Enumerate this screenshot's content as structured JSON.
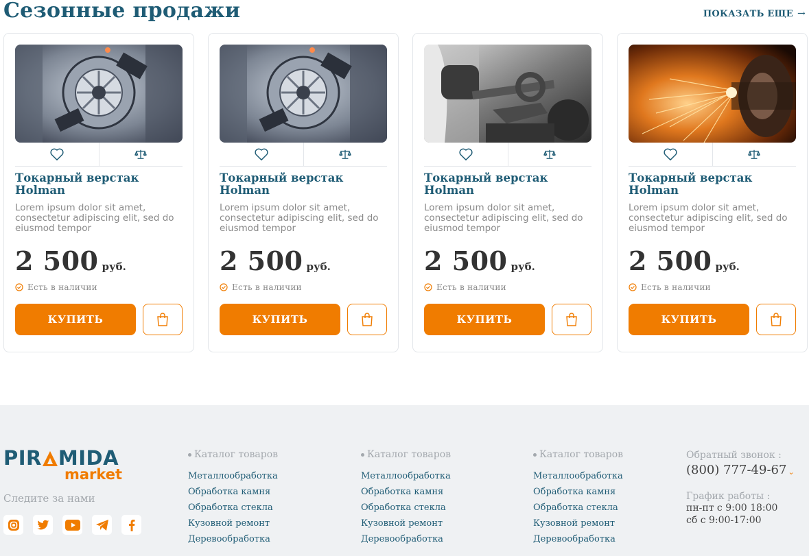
{
  "section": {
    "title": "Сезонные продажи",
    "show_more": "ПОКАЗАТЬ ЕЩЕ"
  },
  "products": [
    {
      "image": "lathe-machine-photo",
      "title": "Токарный верстак Holman",
      "description": "Lorem ipsum dolor sit amet, consectetur adipiscing elit, sed do eiusmod tempor",
      "price": "2 500",
      "currency": "руб.",
      "stock": "Есть в наличии",
      "buy_label": "КУПИТЬ"
    },
    {
      "image": "lathe-machine-photo",
      "title": "Токарный верстак Holman",
      "description": "Lorem ipsum dolor sit amet, consectetur adipiscing elit, sed do eiusmod tempor",
      "price": "2 500",
      "currency": "руб.",
      "stock": "Есть в наличии",
      "buy_label": "КУПИТЬ"
    },
    {
      "image": "wrench-worker-photo",
      "title": "Токарный верстак Holman",
      "description": "Lorem ipsum dolor sit amet, consectetur adipiscing elit, sed do eiusmod tempor",
      "price": "2 500",
      "currency": "руб.",
      "stock": "Есть в наличии",
      "buy_label": "КУПИТЬ"
    },
    {
      "image": "grinding-sparks-photo",
      "title": "Токарный верстак Holman",
      "description": "Lorem ipsum dolor sit amet, consectetur adipiscing elit, sed do eiusmod tempor",
      "price": "2 500",
      "currency": "руб.",
      "stock": "Есть в наличии",
      "buy_label": "КУПИТЬ"
    }
  ],
  "footer": {
    "logo": {
      "top_pre": "PIR",
      "top_post": "MIDA",
      "bottom": "market"
    },
    "follow": "Следите за нами",
    "socials": [
      "instagram-icon",
      "twitter-icon",
      "youtube-icon",
      "telegram-icon",
      "facebook-icon"
    ],
    "columns": [
      {
        "heading": "Каталог товаров",
        "links": [
          "Металлообработка",
          "Обработка камня",
          "Обработка стекла",
          "Кузовной ремонт",
          "Деревообработка"
        ]
      },
      {
        "heading": "Каталог товаров",
        "links": [
          "Металлообработка",
          "Обработка камня",
          "Обработка стекла",
          "Кузовной ремонт",
          "Деревообработка"
        ]
      },
      {
        "heading": "Каталог товаров",
        "links": [
          "Металлообработка",
          "Обработка камня",
          "Обработка стекла",
          "Кузовной ремонт",
          "Деревообработка"
        ]
      }
    ],
    "contact": {
      "callback_label": "Обратный звонок :",
      "phone": "(800) 777-49-67",
      "schedule_label": "График работы :",
      "hours": [
        "пн-пт с 9:00 18:00",
        "сб с 9:00-17:00"
      ]
    }
  },
  "colors": {
    "brand_blue": "#1f5c75",
    "accent_orange": "#f07c00",
    "footer_bg": "#eff1f3",
    "muted": "#a3a8ad"
  }
}
